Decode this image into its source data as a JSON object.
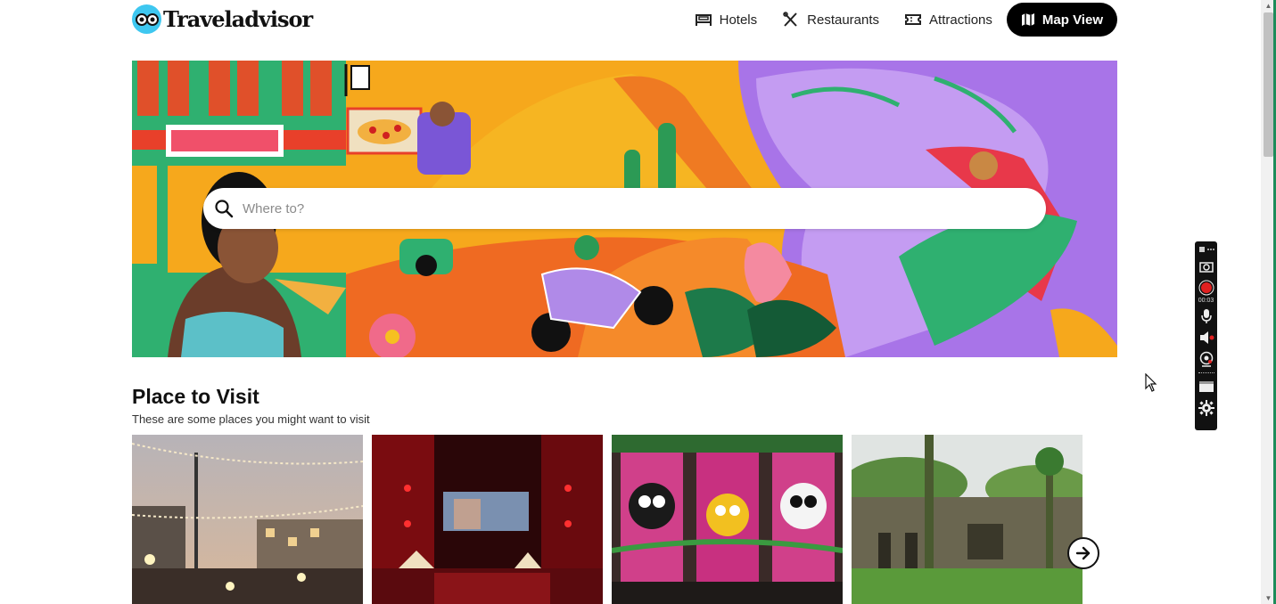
{
  "header": {
    "logo_text": "Traveladvisor",
    "nav": [
      {
        "label": "Hotels",
        "icon": "bed-icon"
      },
      {
        "label": "Restaurants",
        "icon": "cutlery-icon"
      },
      {
        "label": "Attractions",
        "icon": "ticket-icon"
      },
      {
        "label": "Map View",
        "icon": "map-icon"
      }
    ]
  },
  "hero": {
    "search_placeholder": "Where to?"
  },
  "section": {
    "title": "Place to Visit",
    "subtitle": "These are some places you might want to visit"
  },
  "cards": [
    {
      "subject": "street-with-lights"
    },
    {
      "subject": "cinema-hall"
    },
    {
      "subject": "temple-deities"
    },
    {
      "subject": "caves"
    }
  ],
  "recorder": {
    "timer": "00:03"
  },
  "colors": {
    "accent": "#000000",
    "logo_blue": "#3ec7f0",
    "record_red": "#e02020"
  }
}
